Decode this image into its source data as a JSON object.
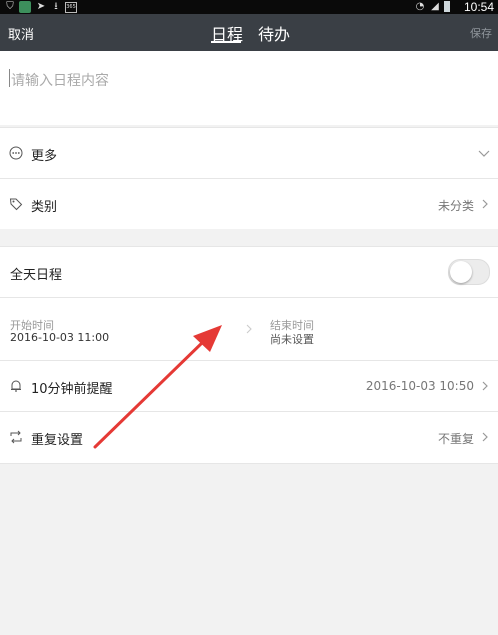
{
  "status_bar": {
    "time": "10:54",
    "icons": [
      "shield-icon",
      "app-icon",
      "send-icon",
      "download-icon",
      "calendar-icon",
      "wifi-icon",
      "signal-icon",
      "battery-icon"
    ]
  },
  "nav": {
    "cancel": "取消",
    "tabs": [
      {
        "label": "日程",
        "active": true
      },
      {
        "label": "待办",
        "active": false
      }
    ],
    "save": "保存"
  },
  "input": {
    "placeholder": "请输入日程内容"
  },
  "rows": {
    "more": {
      "label": "更多"
    },
    "category": {
      "label": "类别",
      "value": "未分类"
    },
    "all_day": {
      "label": "全天日程",
      "on": false
    },
    "start": {
      "label": "开始时间",
      "value": "2016-10-03 11:00"
    },
    "end": {
      "label": "结束时间",
      "value": "尚未设置"
    },
    "reminder": {
      "label": "10分钟前提醒",
      "value": "2016-10-03 10:50"
    },
    "repeat": {
      "label": "重复设置",
      "value": "不重复"
    }
  },
  "colors": {
    "nav_bg": "#3a3f45",
    "status_bg": "#0a0a0a",
    "annotation_arrow": "#e53935"
  }
}
